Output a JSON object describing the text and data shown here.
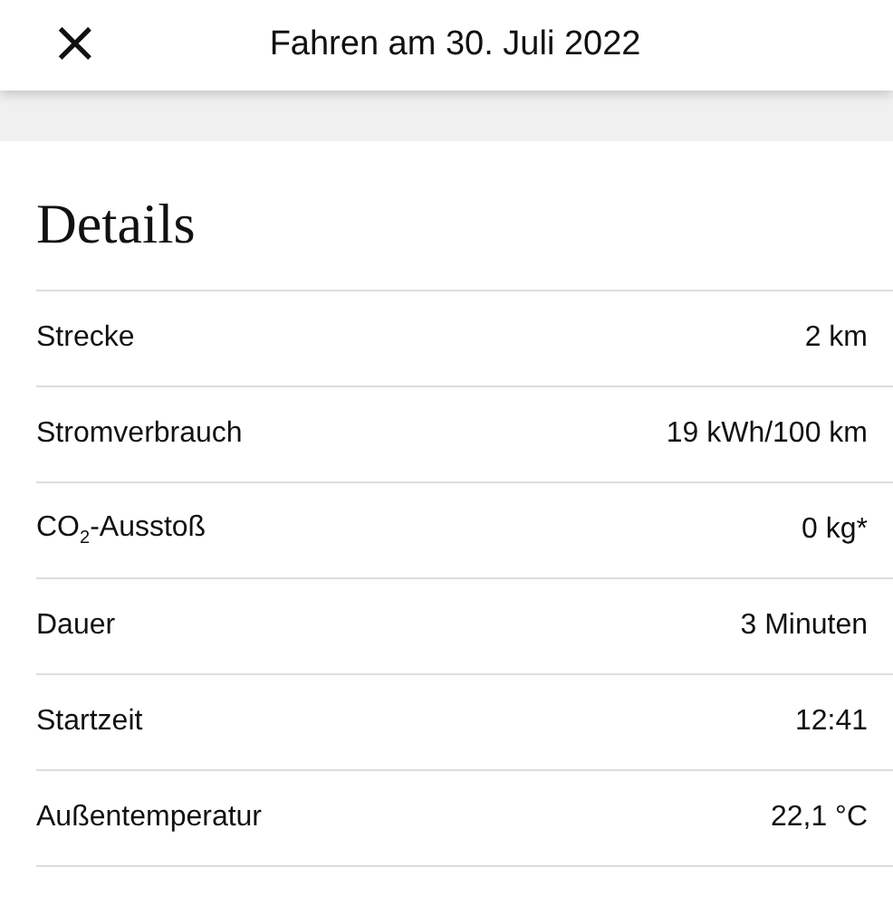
{
  "header": {
    "close": "×",
    "title": "Fahren am 30. Juli 2022"
  },
  "details": {
    "heading": "Details",
    "rows": [
      {
        "label": "Strecke",
        "value": "2 km"
      },
      {
        "label": "Stromverbrauch",
        "value": "19 kWh/100 km"
      },
      {
        "label": "CO$_{2}$-Ausstoß",
        "value": "0 kg*"
      },
      {
        "label": "Dauer",
        "value": "3 Minuten"
      },
      {
        "label": "Startzeit",
        "value": "12:41"
      },
      {
        "label": "Außentemperatur",
        "value": "22,1 °C"
      }
    ]
  }
}
